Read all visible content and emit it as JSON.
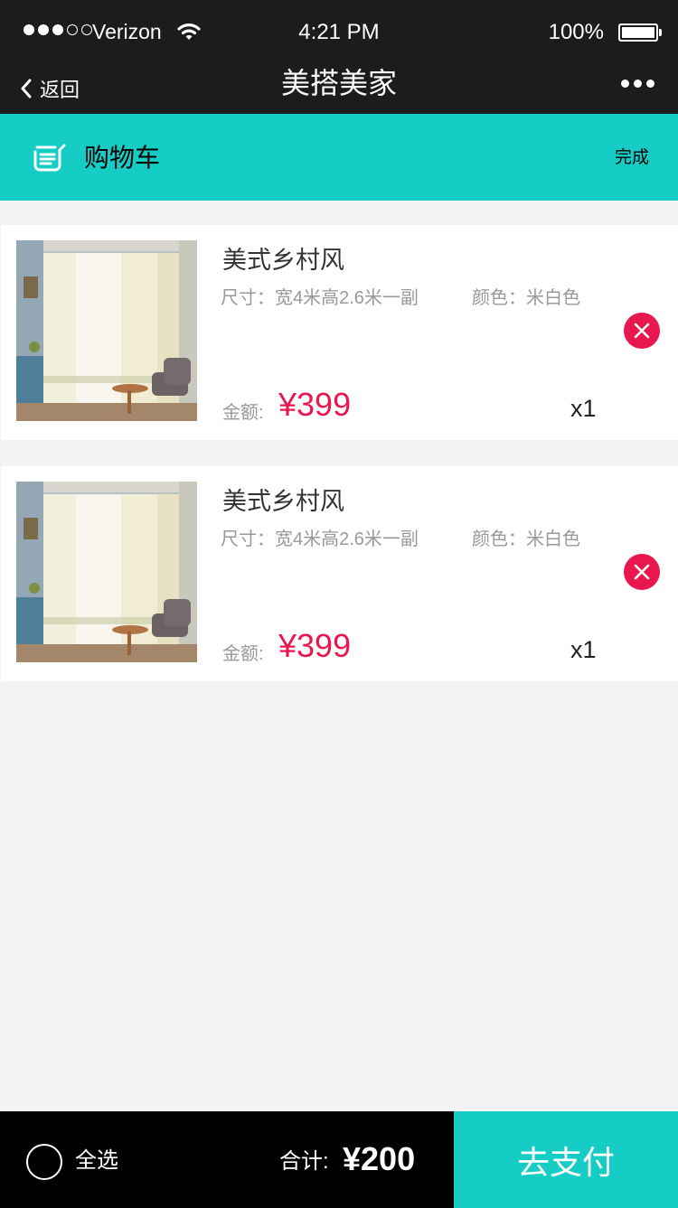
{
  "status_bar": {
    "carrier": "Verizon",
    "time": "4:21 PM",
    "battery": "100%",
    "signal_bars": 3,
    "signal_total": 5
  },
  "nav": {
    "back_label": "返回",
    "title": "美搭美家"
  },
  "cart_header": {
    "title": "购物车",
    "done_label": "完成"
  },
  "items": [
    {
      "name": "美式乡村风",
      "size": "尺寸：宽4米高2.6米一副",
      "color": "颜色：米白色",
      "price_label": "金额:",
      "price": "¥399",
      "quantity": "x1"
    },
    {
      "name": "美式乡村风",
      "size": "尺寸：宽4米高2.6米一副",
      "color": "颜色：米白色",
      "price_label": "金额:",
      "price": "¥399",
      "quantity": "x1"
    }
  ],
  "footer": {
    "select_all_label": "全选",
    "total_label": "合计:",
    "total_value": "¥200",
    "pay_label": "去支付"
  },
  "colors": {
    "accent": "#16cdc5",
    "price": "#e8184e",
    "bar": "#1c1c1c"
  },
  "icons": [
    "back-chevron-icon",
    "more-dots-icon",
    "cart-list-icon",
    "wifi-icon",
    "delete-circle-icon"
  ]
}
